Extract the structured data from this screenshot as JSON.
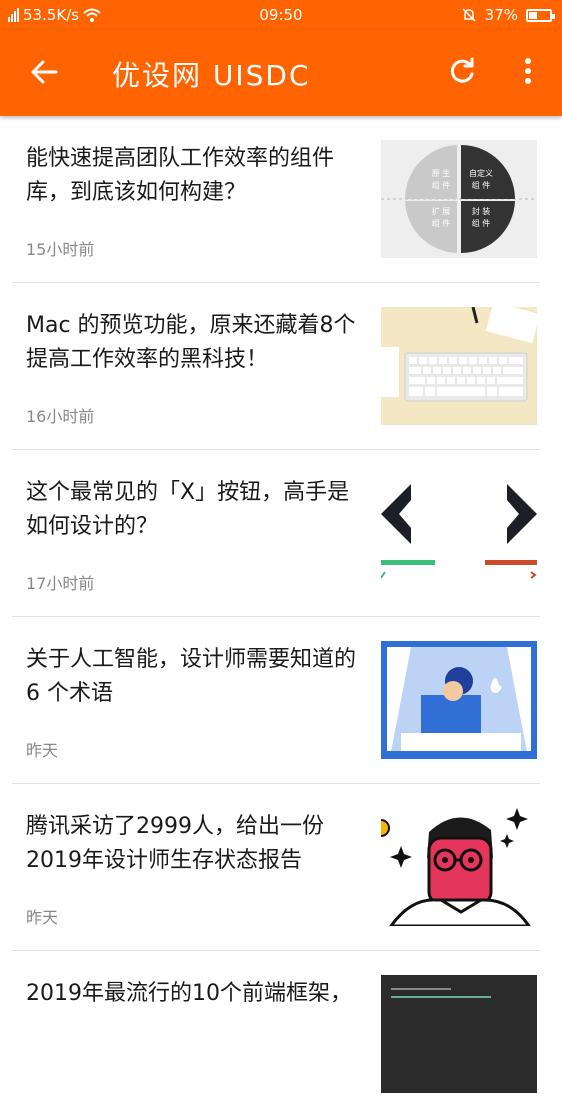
{
  "status_bar": {
    "network_speed": "53.5K/s",
    "time": "09:50",
    "battery": "37%",
    "battery_level": 0.37
  },
  "app_bar": {
    "title": "优设网 UISDC",
    "back_icon": "arrow-back-icon",
    "refresh_icon": "refresh-icon",
    "more_icon": "more-vert-icon"
  },
  "articles": [
    {
      "title": "能快速提高团队工作效率的组件库，到底该如何构建？",
      "time": "15小时前",
      "thumb": {
        "q1": "原 生",
        "q1b": "组 件",
        "q2": "自定义",
        "q2b": "组 件",
        "q3": "扩 展",
        "q3b": "组 件",
        "q4": "封 装",
        "q4b": "组 件"
      }
    },
    {
      "title": "Mac 的预览功能，原来还藏着8个提高工作效率的黑科技！",
      "time": "16小时前"
    },
    {
      "title": "这个最常见的「X」按钮，高手是如何设计的？",
      "time": "17小时前"
    },
    {
      "title": "关于人工智能，设计师需要知道的 6 个术语",
      "time": "昨天"
    },
    {
      "title": "腾讯采访了2999人，给出一份2019年设计师生存状态报告",
      "time": "昨天"
    },
    {
      "title": "2019年最流行的10个前端框架，",
      "time": ""
    }
  ],
  "colors": {
    "primary": "#ff6400",
    "text": "#1a1a1a",
    "meta": "#888888"
  }
}
